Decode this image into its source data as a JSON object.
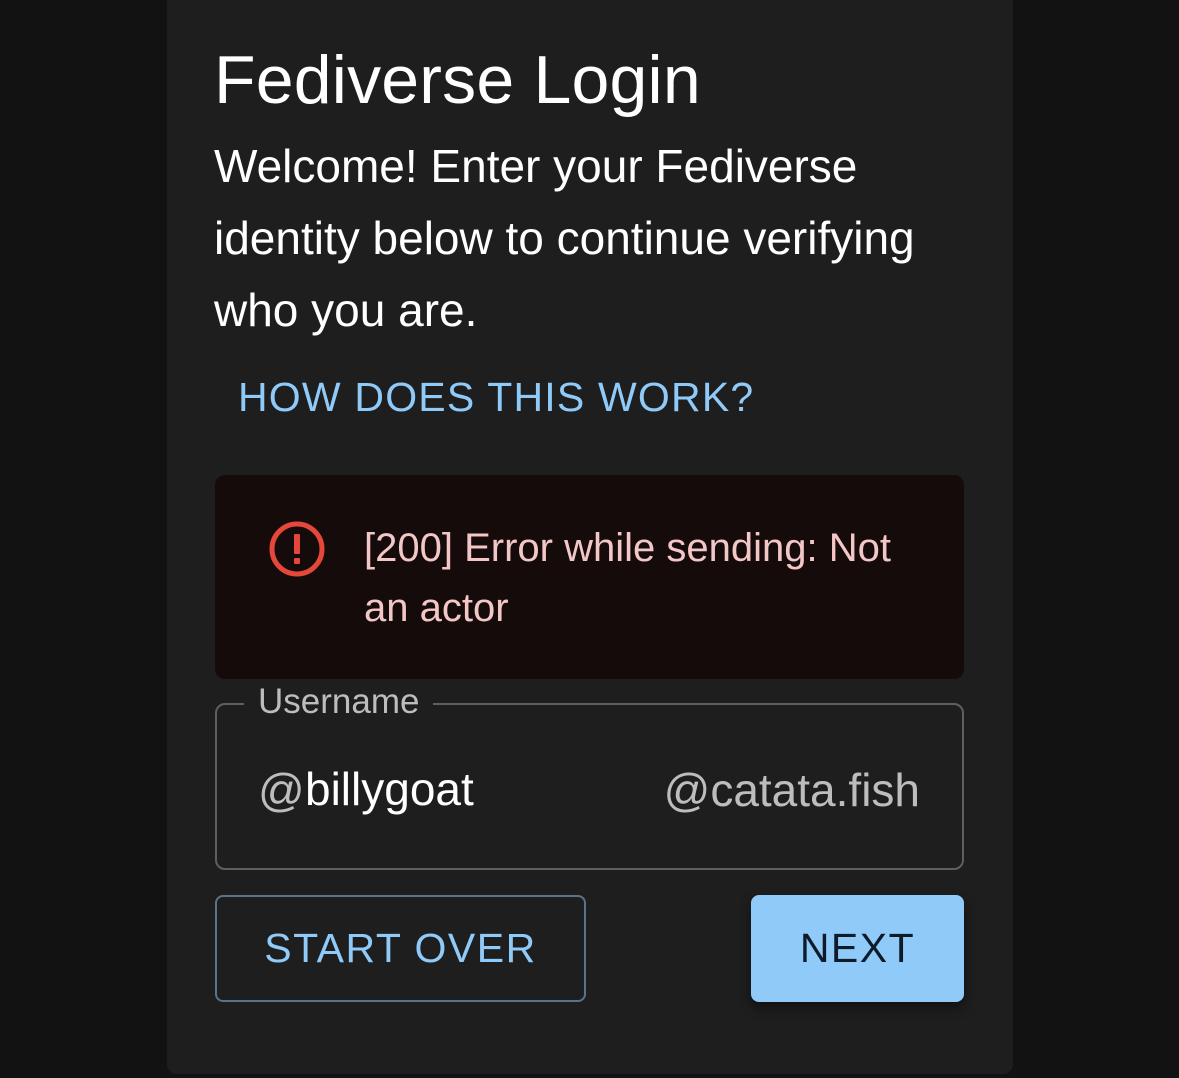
{
  "page": {
    "title": "Fediverse Login",
    "welcome": "Welcome! Enter your Fediverse identity below to continue verifying who you are.",
    "help_link": "HOW DOES THIS WORK?"
  },
  "alert": {
    "severity": "error",
    "icon": "error-outline-icon",
    "message": "[200] Error while sending: Not an actor",
    "color": "#e5483b"
  },
  "username_field": {
    "label": "Username",
    "prefix": "@",
    "value": "billygoat",
    "suffix": "@catata.fish"
  },
  "actions": {
    "start_over_label": "START OVER",
    "next_label": "NEXT"
  },
  "colors": {
    "accent": "#90caf9",
    "card_background": "#1e1e1e",
    "page_background": "#121212",
    "alert_background": "#160b0b",
    "alert_text": "#f4c7c7"
  }
}
